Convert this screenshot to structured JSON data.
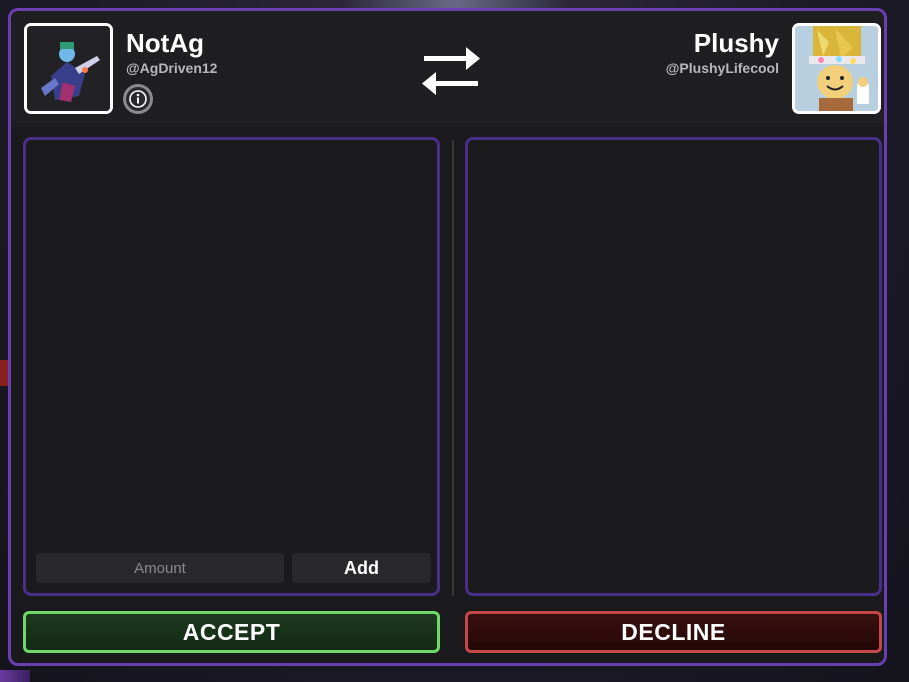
{
  "trade": {
    "left_user": {
      "display_name": "NotAg",
      "username": "@AgDriven12"
    },
    "right_user": {
      "display_name": "Plushy",
      "username": "@PlushyLifecool"
    },
    "icons": {
      "info": "info-icon",
      "swap": "swap-arrows-icon"
    },
    "offer_panel": {
      "amount_placeholder": "Amount",
      "amount_value": "",
      "add_label": "Add"
    },
    "actions": {
      "accept_label": "ACCEPT",
      "decline_label": "DECLINE"
    },
    "colors": {
      "window_border": "#6a3fb0",
      "panel_border": "#4a2f8a",
      "accept_border": "#6fd86a",
      "decline_border": "#c44848"
    }
  }
}
